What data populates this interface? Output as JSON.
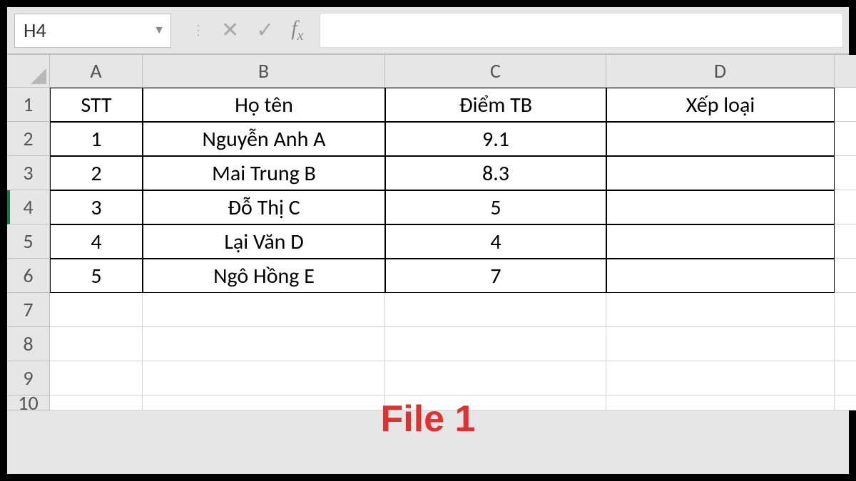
{
  "namebox": {
    "cell_ref": "H4"
  },
  "formula_bar": {
    "value": ""
  },
  "columns": [
    "A",
    "B",
    "C",
    "D"
  ],
  "row_numbers": [
    "1",
    "2",
    "3",
    "4",
    "5",
    "6",
    "7",
    "8",
    "9",
    "10"
  ],
  "selected_row": "4",
  "headers": {
    "stt": "STT",
    "hoten": "Họ tên",
    "diemtb": "Điểm TB",
    "xeploai": "Xếp loại"
  },
  "rows": [
    {
      "stt": "1",
      "hoten": "Nguyễn Anh A",
      "diemtb": "9.1",
      "xeploai": ""
    },
    {
      "stt": "2",
      "hoten": "Mai Trung B",
      "diemtb": "8.3",
      "xeploai": ""
    },
    {
      "stt": "3",
      "hoten": "Đỗ Thị C",
      "diemtb": "5",
      "xeploai": ""
    },
    {
      "stt": "4",
      "hoten": "Lại Văn D",
      "diemtb": "4",
      "xeploai": ""
    },
    {
      "stt": "5",
      "hoten": "Ngô Hồng E",
      "diemtb": "7",
      "xeploai": ""
    }
  ],
  "overlay_label": "File 1"
}
